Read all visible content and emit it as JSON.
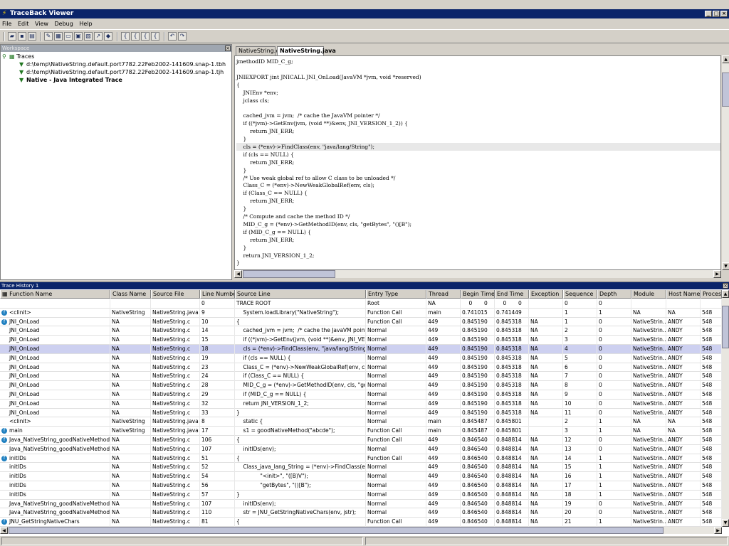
{
  "window": {
    "title": "TraceBack Viewer",
    "minimize": "_",
    "maximize": "□",
    "close": "×"
  },
  "menu": [
    "File",
    "Edit",
    "View",
    "Debug",
    "Help"
  ],
  "toolbar": {
    "icons": [
      "open-folder-icon",
      "save-icon",
      "print-icon",
      "edit-icon",
      "view-icon",
      "window-icon",
      "report-icon",
      "export-icon",
      "goto-icon",
      "search-icon",
      "bracket-icon-1",
      "bracket-icon-2",
      "bracket-icon-3",
      "bracket-icon-4",
      "step-back-icon",
      "step-forward-icon"
    ]
  },
  "workspace": {
    "title": "Workspace",
    "root": "Traces",
    "items": [
      "d:\\temp\\NativeString.default.port7782.22Feb2002-141609.snap-1.tbh",
      "d:\\temp\\NativeString.default.port7782.22Feb2002-141609.snap-1.tjh",
      "Native - Java Integrated Trace"
    ]
  },
  "editor": {
    "tabs": [
      "NativeString.c",
      "NativeString.java"
    ],
    "lines": [
      "jmethodID MID_C_g;",
      "",
      "JNIEXPORT jint JNICALL JNI_OnLoad(JavaVM *jvm, void *reserved)",
      "{",
      "    JNIEnv *env;",
      "    jclass cls;",
      "",
      "    cached_jvm = jvm;  /* cache the JavaVM pointer */",
      "    if ((*jvm)->GetEnv(jvm, (void **)&env, JNI_VERSION_1_2)) {",
      "        return JNI_ERR;",
      "    }",
      "    cls = (*env)->FindClass(env, \"java/lang/String\");",
      "    if (cls == NULL) {",
      "        return JNI_ERR;",
      "    }",
      "    /* Use weak global ref to allow C class to be unloaded */",
      "    Class_C = (*env)->NewWeakGlobalRef(env, cls);",
      "    if (Class_C == NULL) {",
      "        return JNI_ERR;",
      "    }",
      "    /* Compute and cache the method ID */",
      "    MID_C_g = (*env)->GetMethodID(env, cls, \"getBytes\", \"()[B\");",
      "    if (MID_C_g == NULL) {",
      "        return JNI_ERR;",
      "    }",
      "    return JNI_VERSION_1_2;",
      "}"
    ]
  },
  "history": {
    "title": "Trace History 1",
    "columns": [
      "Function Name",
      "Class Name",
      "Source File",
      "Line Number",
      "Source Line",
      "Entry Type",
      "Thread",
      "Begin Time",
      "End Time",
      "Exception",
      "Sequence",
      "Depth",
      "Module",
      "Host Name",
      "Process"
    ],
    "rows": [
      [
        "",
        "",
        "",
        "0",
        "TRACE ROOT",
        "Root",
        "NA",
        "    0       0",
        "    0       0",
        "",
        "0",
        "0",
        "",
        "",
        ""
      ],
      [
        "<clinit>",
        "NativeString",
        "NativeString.java",
        "9",
        "    System.loadLibrary(\"NativeString\");",
        "Function Call",
        "main",
        "0.741015",
        "0.741449",
        "",
        "1",
        "1",
        "NA",
        "NA",
        "548"
      ],
      [
        "JNI_OnLoad",
        "NA",
        "NativeString.c",
        "10",
        "{",
        "Function Call",
        "449",
        "0.845190",
        "0.845318",
        "NA",
        "1",
        "0",
        "NativeStrin...",
        "ANDY",
        "548"
      ],
      [
        "JNI_OnLoad",
        "NA",
        "NativeString.c",
        "14",
        "    cached_jvm = jvm;  /* cache the JavaVM pointer */",
        "Normal",
        "449",
        "0.845190",
        "0.845318",
        "NA",
        "2",
        "0",
        "NativeStrin...",
        "ANDY",
        "548"
      ],
      [
        "JNI_OnLoad",
        "NA",
        "NativeString.c",
        "15",
        "    if ((*jvm)->GetEnv(jvm, (void **)&env, JNI_VERSI...",
        "Normal",
        "449",
        "0.845190",
        "0.845318",
        "NA",
        "3",
        "0",
        "NativeStrin...",
        "ANDY",
        "548"
      ],
      [
        "JNI_OnLoad",
        "NA",
        "NativeString.c",
        "18",
        "    cls = (*env)->FindClass(env, \"java/lang/String\");",
        "Normal",
        "449",
        "0.845190",
        "0.845318",
        "NA",
        "4",
        "0",
        "NativeStrin...",
        "ANDY",
        "548"
      ],
      [
        "JNI_OnLoad",
        "NA",
        "NativeString.c",
        "19",
        "    if (cls == NULL) {",
        "Normal",
        "449",
        "0.845190",
        "0.845318",
        "NA",
        "5",
        "0",
        "NativeStrin...",
        "ANDY",
        "548"
      ],
      [
        "JNI_OnLoad",
        "NA",
        "NativeString.c",
        "23",
        "    Class_C = (*env)->NewWeakGlobalRef(env, cls);",
        "Normal",
        "449",
        "0.845190",
        "0.845318",
        "NA",
        "6",
        "0",
        "NativeStrin...",
        "ANDY",
        "548"
      ],
      [
        "JNI_OnLoad",
        "NA",
        "NativeString.c",
        "24",
        "    if (Class_C == NULL) {",
        "Normal",
        "449",
        "0.845190",
        "0.845318",
        "NA",
        "7",
        "0",
        "NativeStrin...",
        "ANDY",
        "548"
      ],
      [
        "JNI_OnLoad",
        "NA",
        "NativeString.c",
        "28",
        "    MID_C_g = (*env)->GetMethodID(env, cls, \"getBy...",
        "Normal",
        "449",
        "0.845190",
        "0.845318",
        "NA",
        "8",
        "0",
        "NativeStrin...",
        "ANDY",
        "548"
      ],
      [
        "JNI_OnLoad",
        "NA",
        "NativeString.c",
        "29",
        "    if (MID_C_g == NULL) {",
        "Normal",
        "449",
        "0.845190",
        "0.845318",
        "NA",
        "9",
        "0",
        "NativeStrin...",
        "ANDY",
        "548"
      ],
      [
        "JNI_OnLoad",
        "NA",
        "NativeString.c",
        "32",
        "    return JNI_VERSION_1_2;",
        "Normal",
        "449",
        "0.845190",
        "0.845318",
        "NA",
        "10",
        "0",
        "NativeStrin...",
        "ANDY",
        "548"
      ],
      [
        "JNI_OnLoad",
        "NA",
        "NativeString.c",
        "33",
        "}",
        "Normal",
        "449",
        "0.845190",
        "0.845318",
        "NA",
        "11",
        "0",
        "NativeStrin...",
        "ANDY",
        "548"
      ],
      [
        "<clinit>",
        "NativeString",
        "NativeString.java",
        "8",
        "    static {",
        "Normal",
        "main",
        "0.845487",
        "0.845801",
        "",
        "2",
        "1",
        "NA",
        "NA",
        "548"
      ],
      [
        "main",
        "NativeString",
        "NativeString.java",
        "17",
        "    s1 = goodNativeMethod(\"abcde\");",
        "Function Call",
        "main",
        "0.845487",
        "0.845801",
        "",
        "3",
        "1",
        "NA",
        "NA",
        "548"
      ],
      [
        "Java_NativeString_goodNativeMethod",
        "NA",
        "NativeString.c",
        "106",
        "{",
        "Function Call",
        "449",
        "0.846540",
        "0.848814",
        "NA",
        "12",
        "0",
        "NativeStrin...",
        "ANDY",
        "548"
      ],
      [
        "Java_NativeString_goodNativeMethod",
        "NA",
        "NativeString.c",
        "107",
        "    initIDs(env);",
        "Normal",
        "449",
        "0.846540",
        "0.848814",
        "NA",
        "13",
        "0",
        "NativeStrin...",
        "ANDY",
        "548"
      ],
      [
        "initIDs",
        "NA",
        "NativeString.c",
        "51",
        "{",
        "Function Call",
        "449",
        "0.846540",
        "0.848814",
        "NA",
        "14",
        "1",
        "NativeStrin...",
        "ANDY",
        "548"
      ],
      [
        "initIDs",
        "NA",
        "NativeString.c",
        "52",
        "    Class_java_lang_String = (*env)->FindClass(env...",
        "Normal",
        "449",
        "0.846540",
        "0.848814",
        "NA",
        "15",
        "1",
        "NativeStrin...",
        "ANDY",
        "548"
      ],
      [
        "initIDs",
        "NA",
        "NativeString.c",
        "54",
        "              \"<init>\", \"([B)V\");",
        "Normal",
        "449",
        "0.846540",
        "0.848814",
        "NA",
        "16",
        "1",
        "NativeStrin...",
        "ANDY",
        "548"
      ],
      [
        "initIDs",
        "NA",
        "NativeString.c",
        "56",
        "              \"getBytes\", \"()[B\");",
        "Normal",
        "449",
        "0.846540",
        "0.848814",
        "NA",
        "17",
        "1",
        "NativeStrin...",
        "ANDY",
        "548"
      ],
      [
        "initIDs",
        "NA",
        "NativeString.c",
        "57",
        "}",
        "Normal",
        "449",
        "0.846540",
        "0.848814",
        "NA",
        "18",
        "1",
        "NativeStrin...",
        "ANDY",
        "548"
      ],
      [
        "Java_NativeString_goodNativeMethod",
        "NA",
        "NativeString.c",
        "107",
        "    initIDs(env);",
        "Normal",
        "449",
        "0.846540",
        "0.848814",
        "NA",
        "19",
        "0",
        "NativeStrin...",
        "ANDY",
        "548"
      ],
      [
        "Java_NativeString_goodNativeMethod",
        "NA",
        "NativeString.c",
        "110",
        "    str = JNU_GetStringNativeChars(env, jstr);",
        "Normal",
        "449",
        "0.846540",
        "0.848814",
        "NA",
        "20",
        "0",
        "NativeStrin...",
        "ANDY",
        "548"
      ],
      [
        "JNU_GetStringNativeChars",
        "NA",
        "NativeString.c",
        "81",
        "{",
        "Function Call",
        "449",
        "0.846540",
        "0.848814",
        "NA",
        "21",
        "1",
        "NativeStrin...",
        "ANDY",
        "548"
      ]
    ]
  },
  "colors": {
    "title_bar": "#0a246a",
    "selection": "#cdd0f0",
    "string_literal": "#8a2a8a"
  }
}
